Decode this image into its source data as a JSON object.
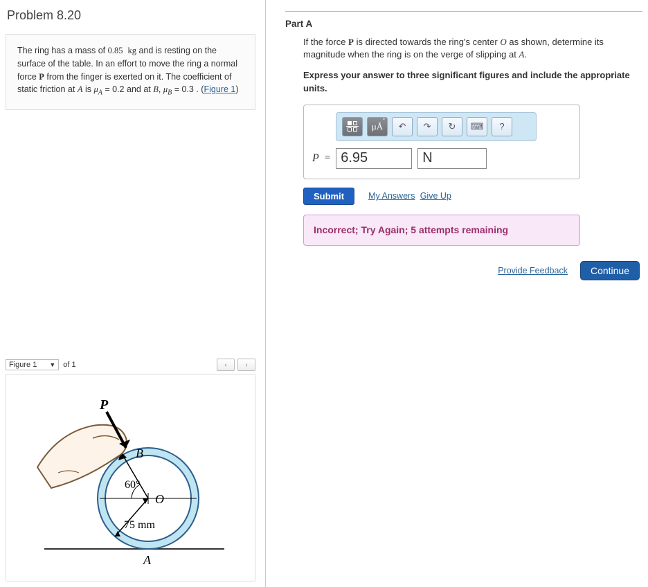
{
  "problem": {
    "title": "Problem 8.20",
    "mass": "0.85",
    "mass_unit": "kg",
    "mu_A": "0.2",
    "mu_B": "0.3",
    "figure_link": "Figure 1",
    "desc_pre": "The ring has a mass of ",
    "desc_post_mass": " and is resting on the surface of the table. In an effort to move the ring a normal force ",
    "desc_post_P": " from the finger is exerted on it. The coefficient of static friction at ",
    "desc_is": " is ",
    "desc_eqA": " = ",
    "desc_andB": " and at ",
    "desc_eqB": " = ",
    "desc_period": ". (",
    "desc_close": ")"
  },
  "figure": {
    "selector": "Figure 1",
    "count": "of 1",
    "labels": {
      "P": "P",
      "B": "B",
      "O": "O",
      "A": "A",
      "angle": "60°",
      "radius": "75 mm"
    }
  },
  "part": {
    "label": "Part A",
    "prompt_pre": "If the force ",
    "prompt_mid": " is directed towards the ring's center ",
    "prompt_post": " as shown, determine its magnitude when the ring is on the verge of slipping at ",
    "prompt_end": ".",
    "instruction": "Express your answer to three significant figures and include the appropriate units.",
    "var_label": "P",
    "equals": "=",
    "value": "6.95",
    "unit": "N"
  },
  "toolbar": {
    "templates": "",
    "units": "μÅ",
    "undo": "↶",
    "redo": "↷",
    "reset": "↻",
    "keyboard": "⌨",
    "help": "?"
  },
  "actions": {
    "submit": "Submit",
    "my_answers": "My Answers",
    "give_up": "Give Up"
  },
  "feedback": "Incorrect; Try Again; 5 attempts remaining",
  "footer": {
    "provide_feedback": "Provide Feedback",
    "continue": "Continue"
  }
}
